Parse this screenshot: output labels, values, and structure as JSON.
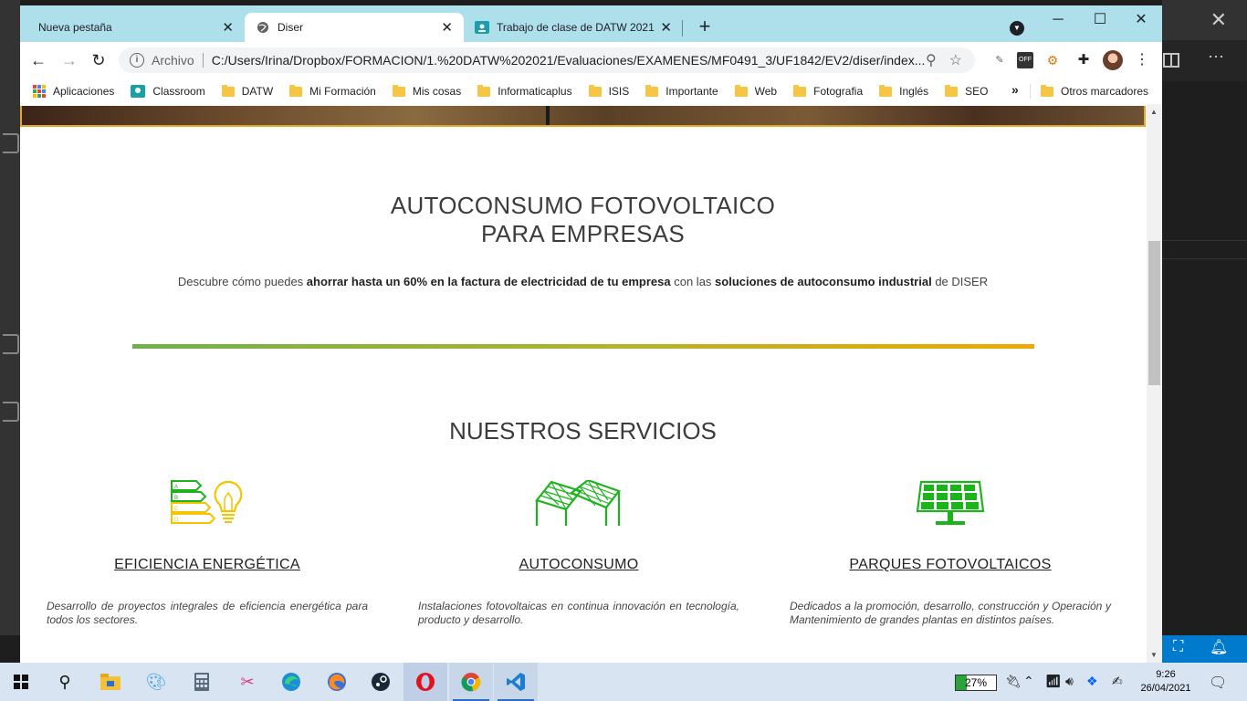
{
  "browser": {
    "tabs": [
      {
        "title": "Nueva pestaña",
        "active": false
      },
      {
        "title": "Diser",
        "active": true
      },
      {
        "title": "Trabajo de clase de DATW 2021 (",
        "active": false
      }
    ],
    "new_tab": "+",
    "window_controls": {
      "minimize": "─",
      "maximize": "☐",
      "close": "✕"
    },
    "address": {
      "scheme_label": "Archivo",
      "url": "C:/Users/Irina/Dropbox/FORMACION/1.%20DATW%202021/Evaluaciones/EXAMENES/MF0491_3/UF1842/EV2/diser/index...."
    },
    "extensions": [
      {
        "name": "ext-eyedropper-icon",
        "glyph": "✎",
        "color": "#5f6368"
      },
      {
        "name": "ext-off-icon",
        "glyph": "OFF",
        "color": "#333"
      },
      {
        "name": "ext-orange-icon",
        "glyph": "⚙",
        "color": "#e8710a"
      },
      {
        "name": "extensions-puzzle-icon",
        "glyph": "✚",
        "color": "#202124"
      }
    ],
    "bookmarks": [
      {
        "label": "Aplicaciones",
        "icon": "apps-grid-icon"
      },
      {
        "label": "Classroom",
        "icon": "classroom-icon"
      },
      {
        "label": "DATW",
        "icon": "folder-icon"
      },
      {
        "label": "Mi Formación",
        "icon": "folder-icon"
      },
      {
        "label": "Mis cosas",
        "icon": "folder-icon"
      },
      {
        "label": "Informaticaplus",
        "icon": "folder-icon"
      },
      {
        "label": "ISIS",
        "icon": "folder-icon"
      },
      {
        "label": "Importante",
        "icon": "folder-icon"
      },
      {
        "label": "Web",
        "icon": "folder-icon"
      },
      {
        "label": "Fotografia",
        "icon": "folder-icon"
      },
      {
        "label": "Inglés",
        "icon": "folder-icon"
      },
      {
        "label": "SEO",
        "icon": "folder-icon"
      }
    ],
    "bookmarks_more": "»",
    "other_bookmarks": "Otros marcadores"
  },
  "page": {
    "heading_line1": "AUTOCONSUMO FOTOVOLTAICO",
    "heading_line2": "PARA EMPRESAS",
    "intro": {
      "p1": "Descubre cómo puedes ",
      "b1": "ahorrar hasta un 60% en la factura de electricidad de tu empresa",
      "p2": " con las ",
      "b2": "soluciones de autoconsumo industrial",
      "p3": " de DISER"
    },
    "services_heading": "NUESTROS SERVICIOS",
    "services": [
      {
        "title": "EFICIENCIA ENERGÉTICA",
        "description": "Desarrollo de proyectos integrales de eficiencia energética para todos los sectores.",
        "icon": "energy-efficiency-bulb-icon"
      },
      {
        "title": "AUTOCONSUMO",
        "description": "Instalaciones fotovoltaicas en continua innovación en tecnología, producto y desarrollo.",
        "icon": "rooftop-solar-panels-icon"
      },
      {
        "title": "PARQUES FOTOVOLTAICOS",
        "description": "Dedicados a la promoción, desarrollo, construcción y Operación y Mantenimiento de grandes plantas en distintos países.",
        "icon": "solar-panel-park-icon"
      }
    ],
    "colors": {
      "icon_green": "#1db31d",
      "icon_yellow": "#f5c400",
      "line_start": "#6fb24a",
      "line_end": "#f0a800",
      "tabstrip": "#aee0ec"
    }
  },
  "taskbar": {
    "battery": "27%",
    "battery_level": 0.27,
    "time": "9:26",
    "date": "26/04/2021"
  }
}
